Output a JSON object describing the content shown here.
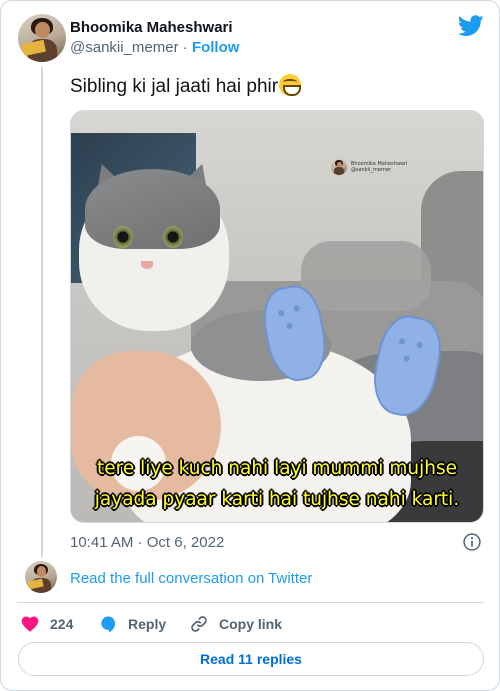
{
  "author": {
    "name": "Bhoomika Maheshwari",
    "handle": "@sankii_memer",
    "separator": "·",
    "follow_label": "Follow"
  },
  "tweet": {
    "text": "Sibling ki jal jaati hai phir",
    "emoji": "grinning-face-with-smiling-eyes"
  },
  "media": {
    "watermark_name": "Bhoomika Maheshwari",
    "watermark_handle": "@sankii_memer",
    "caption_line1": "tere liye kuch nahi layi mummi mujhse",
    "caption_line2": "jayada pyaar karti hai tujhse nahi karti."
  },
  "meta": {
    "time": "10:41 AM",
    "separator": "·",
    "date": "Oct 6, 2022"
  },
  "conversation_link": "Read the full conversation on Twitter",
  "actions": {
    "like_count": "224",
    "reply_label": "Reply",
    "copy_label": "Copy link"
  },
  "replies_button": "Read 11 replies",
  "colors": {
    "accent": "#1d9bf0",
    "like": "#f91880",
    "caption": "#ffff22",
    "muted": "#536471"
  }
}
